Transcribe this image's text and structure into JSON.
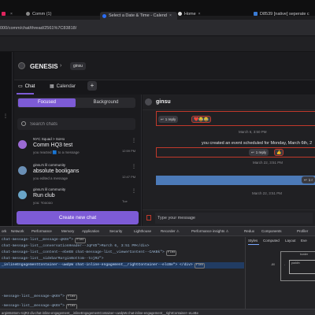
{
  "browser": {
    "tabs": [
      {
        "title": "",
        "icon": "slack-icon"
      },
      {
        "title": "Comm (1)",
        "icon": "comm-icon"
      },
      {
        "title": "Select a Date & Time - Calend",
        "icon": "calendly-icon"
      },
      {
        "title": "Home",
        "icon": "github-icon"
      },
      {
        "title": "D8539 [native] seperate c",
        "icon": "jira-icon"
      }
    ],
    "url": "000/comm/chat/thread/2561%7C83818/"
  },
  "app": {
    "group_name": "GENESIS",
    "user_chip": "ginsu",
    "tabs": {
      "chat": "Chat",
      "calendar": "Calendar",
      "add": "+"
    },
    "segments": {
      "focused": "Focused",
      "background": "Background"
    },
    "search_placeholder": "Search chats",
    "chats": [
      {
        "community": "NYC Squad > SoHo",
        "title": "Comm HQ3 test",
        "subtitle": "you reacted 🟦 to a message",
        "time": "12:59 PM",
        "avatar_color": "#9b6ad4"
      },
      {
        "community": "ginsu's lil community",
        "title": "absolute booligans",
        "subtitle": "you edited a message",
        "time": "12:47 PM",
        "avatar_color": "#6a8fb5"
      },
      {
        "community": "ginsu's lil community",
        "title": "Run club",
        "subtitle": "you: Yooooo",
        "time": "Tue",
        "avatar_color": "#6aa5c8"
      }
    ],
    "create_button": "Create new chat",
    "conversation": {
      "name": "ginsu",
      "reply_1": "1 reply",
      "reactions_1": "❤️😂😂",
      "stamp_1": "March 6, 3:50 PM",
      "system_message": "you created an event scheduled for Monday, March 6th, 2",
      "reply_2": "1 reply",
      "reactions_2": "👍",
      "stamp_2": "March 22, 3:51 PM",
      "reply_3": "1 r",
      "stamp_3": "March 22, 3:51 PM",
      "composer_placeholder": "Type your message"
    }
  },
  "devtools": {
    "tabs": [
      "ork",
      "Network",
      "Performance",
      "Memory",
      "Application",
      "Security",
      "Lighthouse",
      "Recorder ⚠",
      "Performance insights ⚠",
      "Redux",
      "Components",
      "Profiler"
    ],
    "side_tabs": [
      "Styles",
      "Computed",
      "Layout",
      "Eve"
    ],
    "code_lines": [
      {
        "text": "chat-message-list__message-qK6V\"> flex",
        "selected": false
      },
      {
        "text": "chat-message-list__conversationHeader--JqFVD\">March 6, 3:51 PM</div>",
        "selected": false
      },
      {
        "text": "chat-message-list__content--ebeEB chat-message-list__viewerContent--CAKBk\"> flex",
        "selected": false
      },
      {
        "text": "chat-message-list__sidebarMarginBottom--tojR2\">",
        "selected": false
      },
      {
        "text": "_inlineEngagementContainer--uwdpW chat-inline-engagement__rightContainer--elcBe\"> </div> flex",
        "selected": true
      },
      {
        "text": "",
        "selected": false
      },
      {
        "text": "",
        "selected": false
      },
      {
        "text": "",
        "selected": false
      },
      {
        "text": "",
        "selected": false
      },
      {
        "text": "-message-list__message-qK6V\"> flex",
        "selected": false
      },
      {
        "text": "-message-list__message-qK6V\"> flex",
        "selected": false
      }
    ],
    "breadcrumb": "arginBottom--tojR2  div.chat-inline-engagement__inlineEngagementContainer--uwdpW.chat-inline-engagement__rightContainer--eLeBe",
    "box_labels": {
      "border": "border",
      "padding": "paddin",
      "margin": "-",
      "value": "-80"
    }
  }
}
